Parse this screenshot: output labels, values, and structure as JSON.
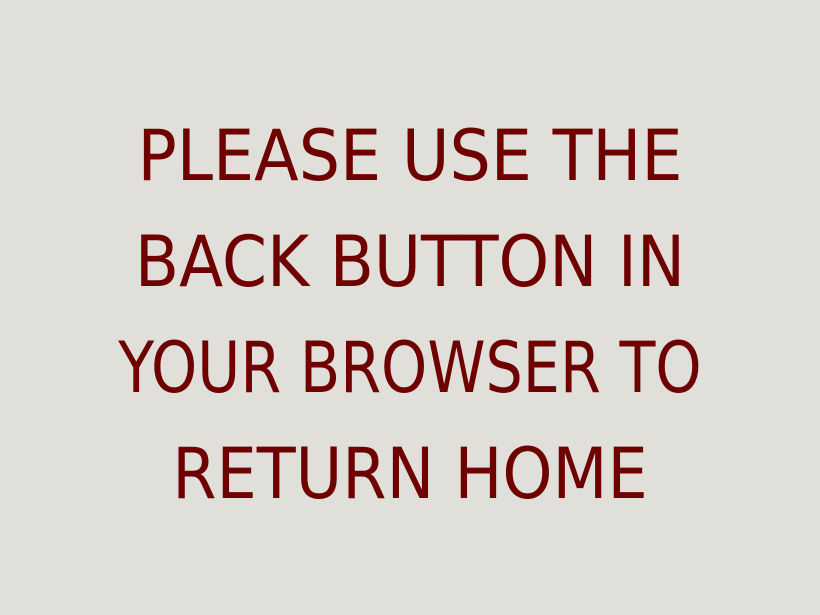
{
  "message": {
    "lines": [
      "PLEASE USE THE",
      "BACK BUTTON IN",
      "YOUR BROWSER TO",
      "RETURN HOME"
    ],
    "text_color": "#6e0000",
    "background_color": "#e0dfd9"
  }
}
